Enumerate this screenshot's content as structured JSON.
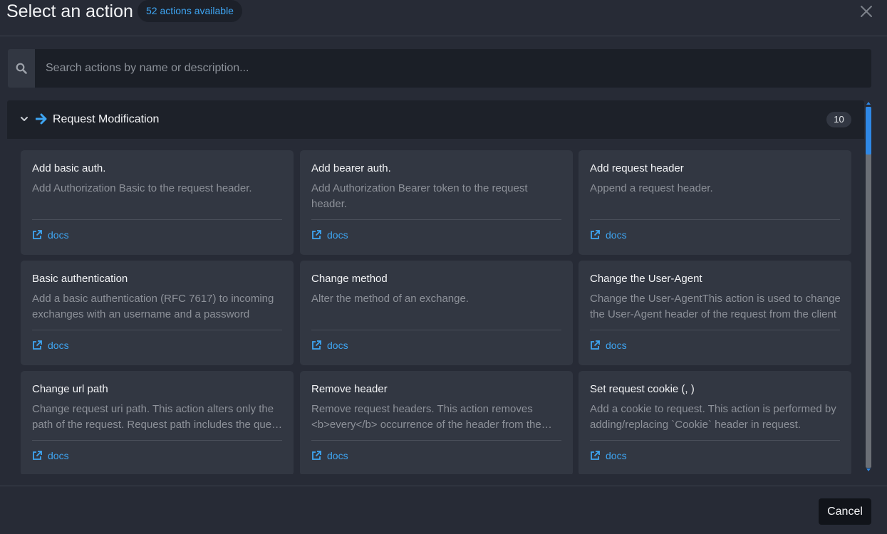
{
  "header": {
    "title": "Select an action",
    "count_badge": "52 actions available"
  },
  "search": {
    "placeholder": "Search actions by name or description...",
    "value": ""
  },
  "group": {
    "title": "Request Modification",
    "count": "10"
  },
  "cards": [
    {
      "title": "Add basic auth.",
      "desc": "Add Authorization Basic to the request header.",
      "docs": "docs"
    },
    {
      "title": "Add bearer auth.",
      "desc": "Add Authorization Bearer token to the request header.",
      "docs": "docs"
    },
    {
      "title": "Add request header",
      "desc": "Append a request header.",
      "docs": "docs"
    },
    {
      "title": "Basic authentication",
      "desc": "Add a basic authentication (RFC 7617) to incoming exchanges with an username and a password",
      "docs": "docs"
    },
    {
      "title": "Change method",
      "desc": "Alter the method of an exchange.",
      "docs": "docs"
    },
    {
      "title": "Change the User-Agent",
      "desc": "Change the User-AgentThis action is used to change the User-Agent header of the request from the client",
      "docs": "docs"
    },
    {
      "title": "Change url path",
      "desc": "Change request uri path. This action alters only the path of the request. Request path includes the query string",
      "docs": "docs"
    },
    {
      "title": "Remove header",
      "desc": "Remove request headers. This action removes <b>every</b> occurrence of the header from the request",
      "docs": "docs"
    },
    {
      "title": "Set request cookie (, )",
      "desc": "Add a cookie to request. This action is performed by adding/replacing `Cookie` header in request.",
      "docs": "docs"
    }
  ],
  "footer": {
    "cancel_label": "Cancel"
  },
  "colors": {
    "background": "#272b36",
    "card": "#323742",
    "accent": "#3ea5f2",
    "muted_text": "#8d9199"
  },
  "icons": [
    "close-icon",
    "search-icon",
    "chevron-down-icon",
    "arrow-right-icon",
    "external-link-icon"
  ]
}
